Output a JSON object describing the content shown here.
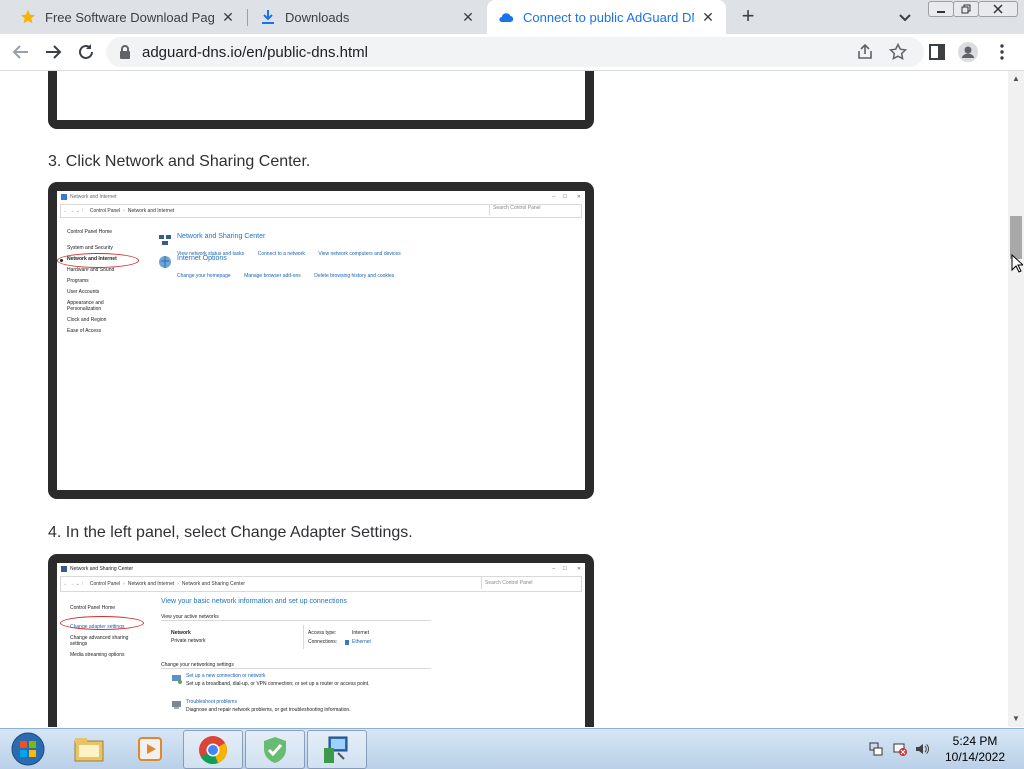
{
  "browser": {
    "tabs": [
      {
        "label": "Free Software Download Page - S",
        "favicon": "star-icon",
        "active": false
      },
      {
        "label": "Downloads",
        "favicon": "download-icon",
        "active": false
      },
      {
        "label": "Connect to public AdGuard DNS",
        "favicon": "cloud-icon",
        "active": true
      }
    ],
    "url": "adguard-dns.io/en/public-dns.html",
    "accent": "#1a73e8"
  },
  "content": {
    "step3": "3. Click Network and Sharing Center.",
    "step4": "4. In the left panel, select Change Adapter Settings."
  },
  "shot1": {
    "title": "Network and Internet",
    "breadcrumb": [
      "Control Panel",
      "Network and Internet"
    ],
    "search_placeholder": "Search Control Panel",
    "sidebar": [
      "Control Panel Home",
      "System and Security",
      "Network and Internet",
      "Hardware and Sound",
      "Programs",
      "User Accounts",
      "Appearance and Personalization",
      "Clock and Region",
      "Ease of Access"
    ],
    "sections": [
      {
        "heading": "Network and Sharing Center",
        "links": [
          "View network status and tasks",
          "Connect to a network",
          "View network computers and devices"
        ]
      },
      {
        "heading": "Internet Options",
        "links": [
          "Change your homepage",
          "Manage browser add-ons",
          "Delete browsing history and cookies"
        ]
      }
    ]
  },
  "shot2": {
    "title": "Network and Sharing Center",
    "breadcrumb": [
      "Control Panel",
      "Network and Internet",
      "Network and Sharing Center"
    ],
    "search_placeholder": "Search Control Panel",
    "sidebar": [
      "Control Panel Home",
      "Change adapter settings",
      "Change advanced sharing settings",
      "Media streaming options"
    ],
    "heading": "View your basic network information and set up connections",
    "active_networks_label": "View your active networks",
    "network_name": "Network",
    "network_type": "Private network",
    "access_type_label": "Access type:",
    "access_type_value": "Internet",
    "connections_label": "Connections:",
    "connections_value": "Ethernet",
    "change_settings_label": "Change your networking settings",
    "tasks": [
      {
        "title": "Set up a new connection or network",
        "desc": "Set up a broadband, dial-up, or VPN connection; or set up a router or access point."
      },
      {
        "title": "Troubleshoot problems",
        "desc": "Diagnose and repair network problems, or get troubleshooting information."
      }
    ]
  },
  "taskbar": {
    "apps": [
      "start-orb",
      "explorer-icon",
      "media-player-icon",
      "chrome-icon",
      "adguard-icon",
      "network-setup-icon"
    ],
    "time": "5:24 PM",
    "date": "10/14/2022"
  }
}
